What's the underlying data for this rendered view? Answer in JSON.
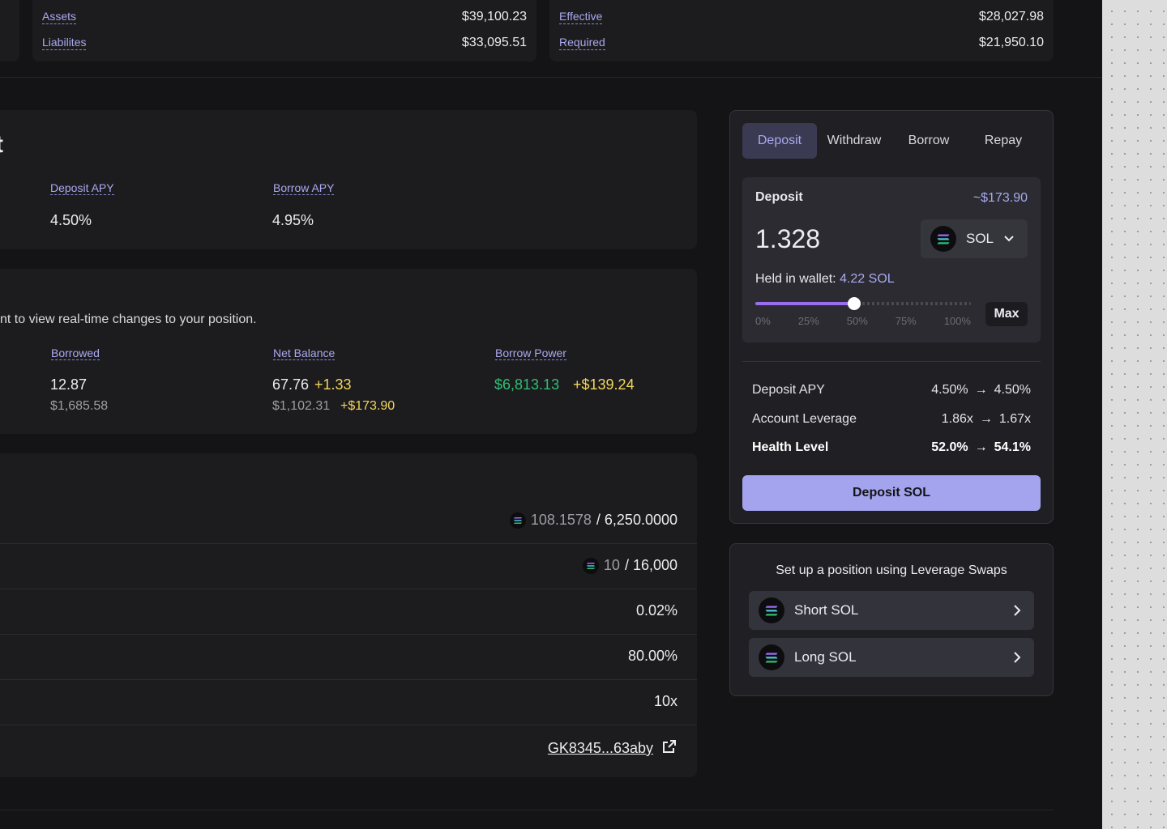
{
  "summary_left": {
    "assets_label": "Assets",
    "assets_value": "$39,100.23",
    "liabilities_label": "Liabilites",
    "liabilities_value": "$33,095.51"
  },
  "summary_right": {
    "effective_label": "Effective",
    "effective_value": "$28,027.98",
    "required_label": "Required",
    "required_value": "$21,950.10"
  },
  "bank_header": {
    "title_fragment": "t",
    "deposit_apy_label": "Deposit APY",
    "deposit_apy_value": "4.50%",
    "borrow_apy_label": "Borrow APY",
    "borrow_apy_value": "4.95%"
  },
  "position": {
    "hint": "nt to view real-time changes to your position.",
    "borrowed_label": "Borrowed",
    "borrowed_value": "12.87",
    "borrowed_usd": "$1,685.58",
    "net_balance_label": "Net Balance",
    "net_balance_value": "67.76",
    "net_balance_delta": "+1.33",
    "net_balance_usd": "$1,102.31",
    "net_balance_usd_delta": "+$173.90",
    "borrow_power_label": "Borrow Power",
    "borrow_power_value": "$6,813.13",
    "borrow_power_delta": "+$139.24"
  },
  "details": {
    "row1_current": "108.1578",
    "row1_max": "/ 6,250.0000",
    "row2_current": "10",
    "row2_max": "/ 16,000",
    "row3": "0.02%",
    "row4": "80.00%",
    "row5": "10x",
    "address": "GK8345...63aby"
  },
  "action_panel": {
    "tabs": [
      "Deposit",
      "Withdraw",
      "Borrow",
      "Repay"
    ],
    "active_tab": "Deposit",
    "input_label": "Deposit",
    "input_usd": "~$173.90",
    "amount": "1.328",
    "token": "SOL",
    "wallet_label": "Held in wallet:",
    "wallet_value": "4.22 SOL",
    "slider_percent": 46,
    "slider_ticks": [
      "0%",
      "25%",
      "50%",
      "75%",
      "100%"
    ],
    "max_label": "Max",
    "stats": [
      {
        "label": "Deposit APY",
        "from": "4.50%",
        "to": "4.50%"
      },
      {
        "label": "Account Leverage",
        "from": "1.86x",
        "to": "1.67x"
      },
      {
        "label": "Health Level",
        "from": "52.0%",
        "to": "54.1%"
      }
    ],
    "arrow": "→",
    "submit_label": "Deposit SOL"
  },
  "leverage_panel": {
    "title": "Set up a position using Leverage Swaps",
    "short_label": "Short SOL",
    "long_label": "Long SOL"
  },
  "colors": {
    "accent": "#a3a3ee",
    "positive": "#2fbf71",
    "delta": "#f3d65b",
    "slider": "#9a6cf0"
  }
}
